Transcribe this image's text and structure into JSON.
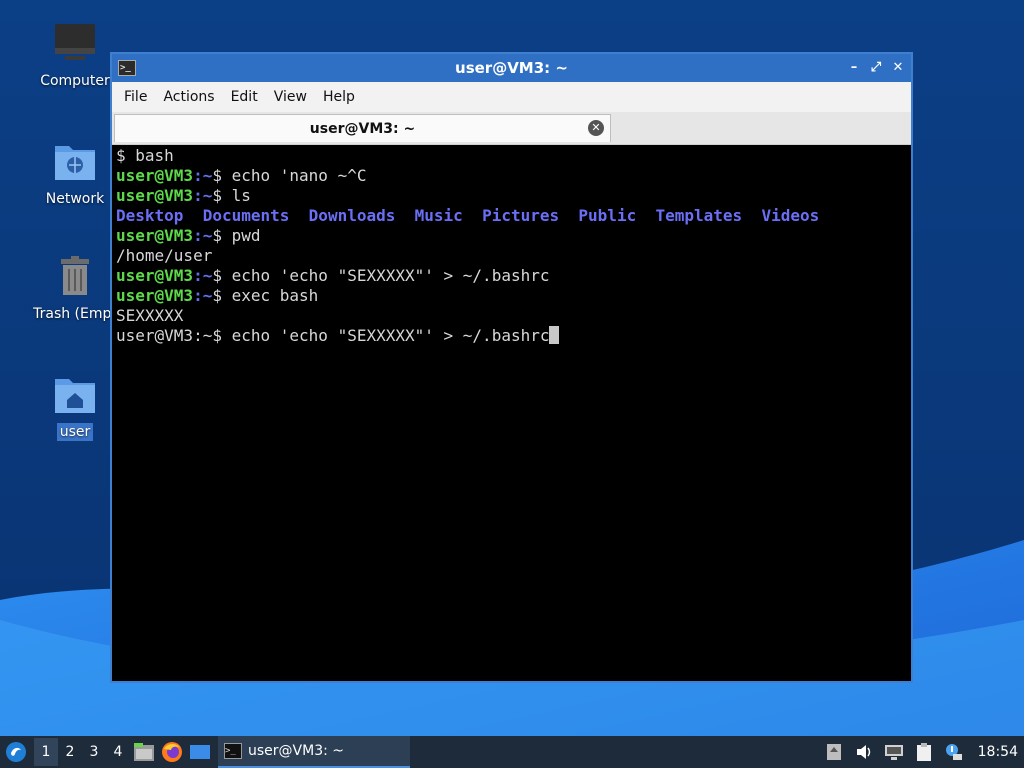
{
  "desktop": {
    "icons": [
      {
        "label": "Computer"
      },
      {
        "label": "Network"
      },
      {
        "label": "Trash (Empt"
      },
      {
        "label": "user"
      }
    ]
  },
  "window": {
    "title": "user@VM3: ~",
    "menu": [
      "File",
      "Actions",
      "Edit",
      "View",
      "Help"
    ],
    "tab_label": "user@VM3: ~"
  },
  "terminal": {
    "prompt_user": "user@VM3",
    "prompt_path": ":~",
    "prompt_symbol": "$",
    "line0": "$ bash",
    "cmd1": " echo 'nano ~^C",
    "cmd2": " ls",
    "ls_dirs": [
      "Desktop",
      "Documents",
      "Downloads",
      "Music",
      "Pictures",
      "Public",
      "Templates",
      "Videos"
    ],
    "cmd3": " pwd",
    "out3": "/home/user",
    "cmd4": " echo 'echo \"SEXXXXX\"' > ~/.bashrc",
    "cmd5": " exec bash",
    "out5": "SEXXXXX",
    "plain_prompt": "user@VM3:~$",
    "cmd6": " echo 'echo \"SEXXXXX\"' > ~/.bashrc"
  },
  "taskbar": {
    "workspaces": [
      "1",
      "2",
      "3",
      "4"
    ],
    "active_workspace": "1",
    "task_label": "user@VM3: ~",
    "clock": "18:54",
    "icons": [
      "start-menu-icon",
      "file-manager-icon",
      "firefox-icon",
      "show-desktop-icon",
      "terminal-icon",
      "upload-icon",
      "volume-icon",
      "network-icon",
      "clipboard-icon",
      "update-notifier-icon"
    ]
  },
  "colors": {
    "titlebar": "#2f6fc4",
    "prompt_user": "#5dd94a",
    "prompt_path": "#5b72f0",
    "directory": "#6a6ff5",
    "taskbar": "#1d2b3a"
  }
}
